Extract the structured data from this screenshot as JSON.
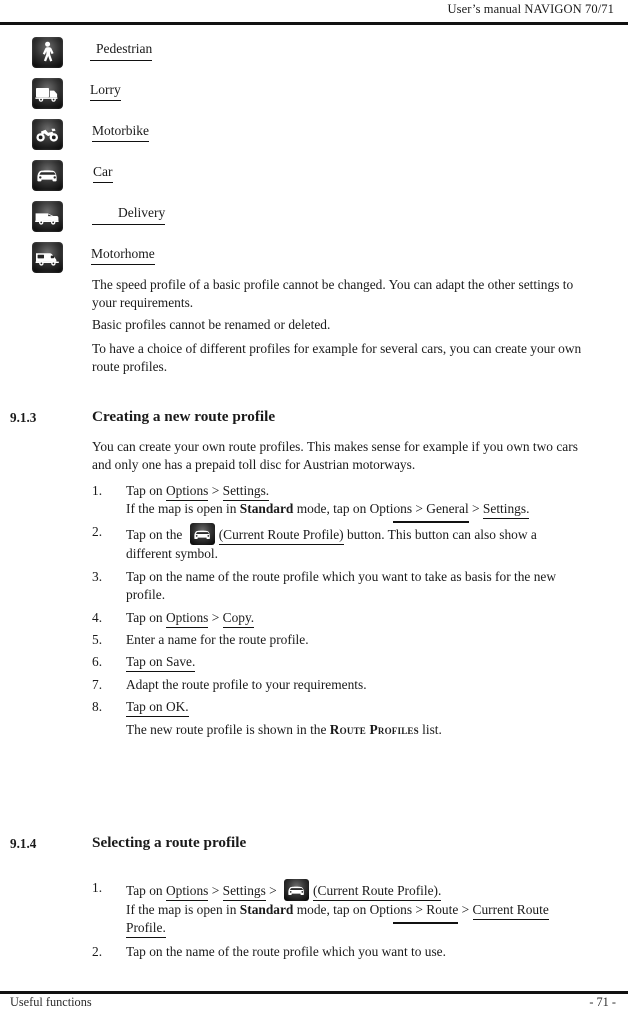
{
  "header": {
    "text": "User’s manual NAVIGON 70/71"
  },
  "footer": {
    "left": "Useful functions",
    "right": "- 71 -"
  },
  "profiles": {
    "items": [
      {
        "label": "Pedestrian",
        "icon": "pedestrian-icon"
      },
      {
        "label": "Lorry",
        "icon": "lorry-icon"
      },
      {
        "label": "Motorbike",
        "icon": "motorbike-icon"
      },
      {
        "label": "Car",
        "icon": "car-icon"
      },
      {
        "label": "Delivery",
        "icon": "delivery-van-icon"
      },
      {
        "label": "Motorhome",
        "icon": "motorhome-icon"
      }
    ]
  },
  "intro": {
    "p1": "The speed profile of a basic profile cannot be changed. You can adapt the other settings to your requirements.",
    "p2": "Basic profiles cannot be renamed or deleted.",
    "p3": "To have a choice of different profiles for example for several cars, you can create your own route profiles."
  },
  "section_913": {
    "number": "9.1.3",
    "title": "Creating a new route profile",
    "intro": "You can create your own route profiles. This makes sense for example if you own two cars and only one has a prepaid toll disc for Austrian motorways.",
    "steps": [
      {
        "num": "1.",
        "text_a": "Tap on ",
        "kw1": "Options",
        "sep1": " > ",
        "kw2": "Settings.",
        "sub_a": "If the map is open in ",
        "sub_bold": "Standard",
        "sub_b": " mode, tap on Opti",
        "sub_kw1": "ons > General",
        "sub_c": " > ",
        "sub_kw2": "Settings."
      },
      {
        "num": "2.",
        "text_a": "Tap on the ",
        "icon": "car-icon",
        "text_b": "(Current Route Profile)",
        "text_c": " button. This button can also show a different symbol."
      },
      {
        "num": "3.",
        "text_a": "Tap on the name of the route profile which you want to take as basis for the new profile."
      },
      {
        "num": "4.",
        "text_a": "Tap on ",
        "kw1": "Options",
        "sep1": " > ",
        "kw2": "Copy."
      },
      {
        "num": "5.",
        "text_a": "Enter a name for the route profile."
      },
      {
        "num": "6.",
        "kw1": "Tap on Save."
      },
      {
        "num": "7.",
        "text_a": "Adapt the route profile to your requirements."
      },
      {
        "num": "8.",
        "kw1": "Tap on OK."
      }
    ],
    "result_a": "The new route profile is shown in the ",
    "result_caps": "Route Profiles",
    "result_b": " list."
  },
  "section_914": {
    "number": "9.1.4",
    "title": "Selecting a route profile",
    "steps": [
      {
        "num": "1.",
        "text_a": "Tap on ",
        "kw1": "Options",
        "sep1": " > ",
        "kw2": "Settings",
        "sep2": " > ",
        "icon": "car-icon",
        "kw3": "(Current Route Profile).",
        "sub_a": "If the map is open in ",
        "sub_bold": "Standard",
        "sub_b": " mode, tap on Opti",
        "sub_kw1": "ons > Route",
        "sub_c": " > ",
        "sub_kw2": "Current Route Profile."
      },
      {
        "num": "2.",
        "text_a": "Tap on the name of the route profile which you want to use."
      }
    ]
  }
}
